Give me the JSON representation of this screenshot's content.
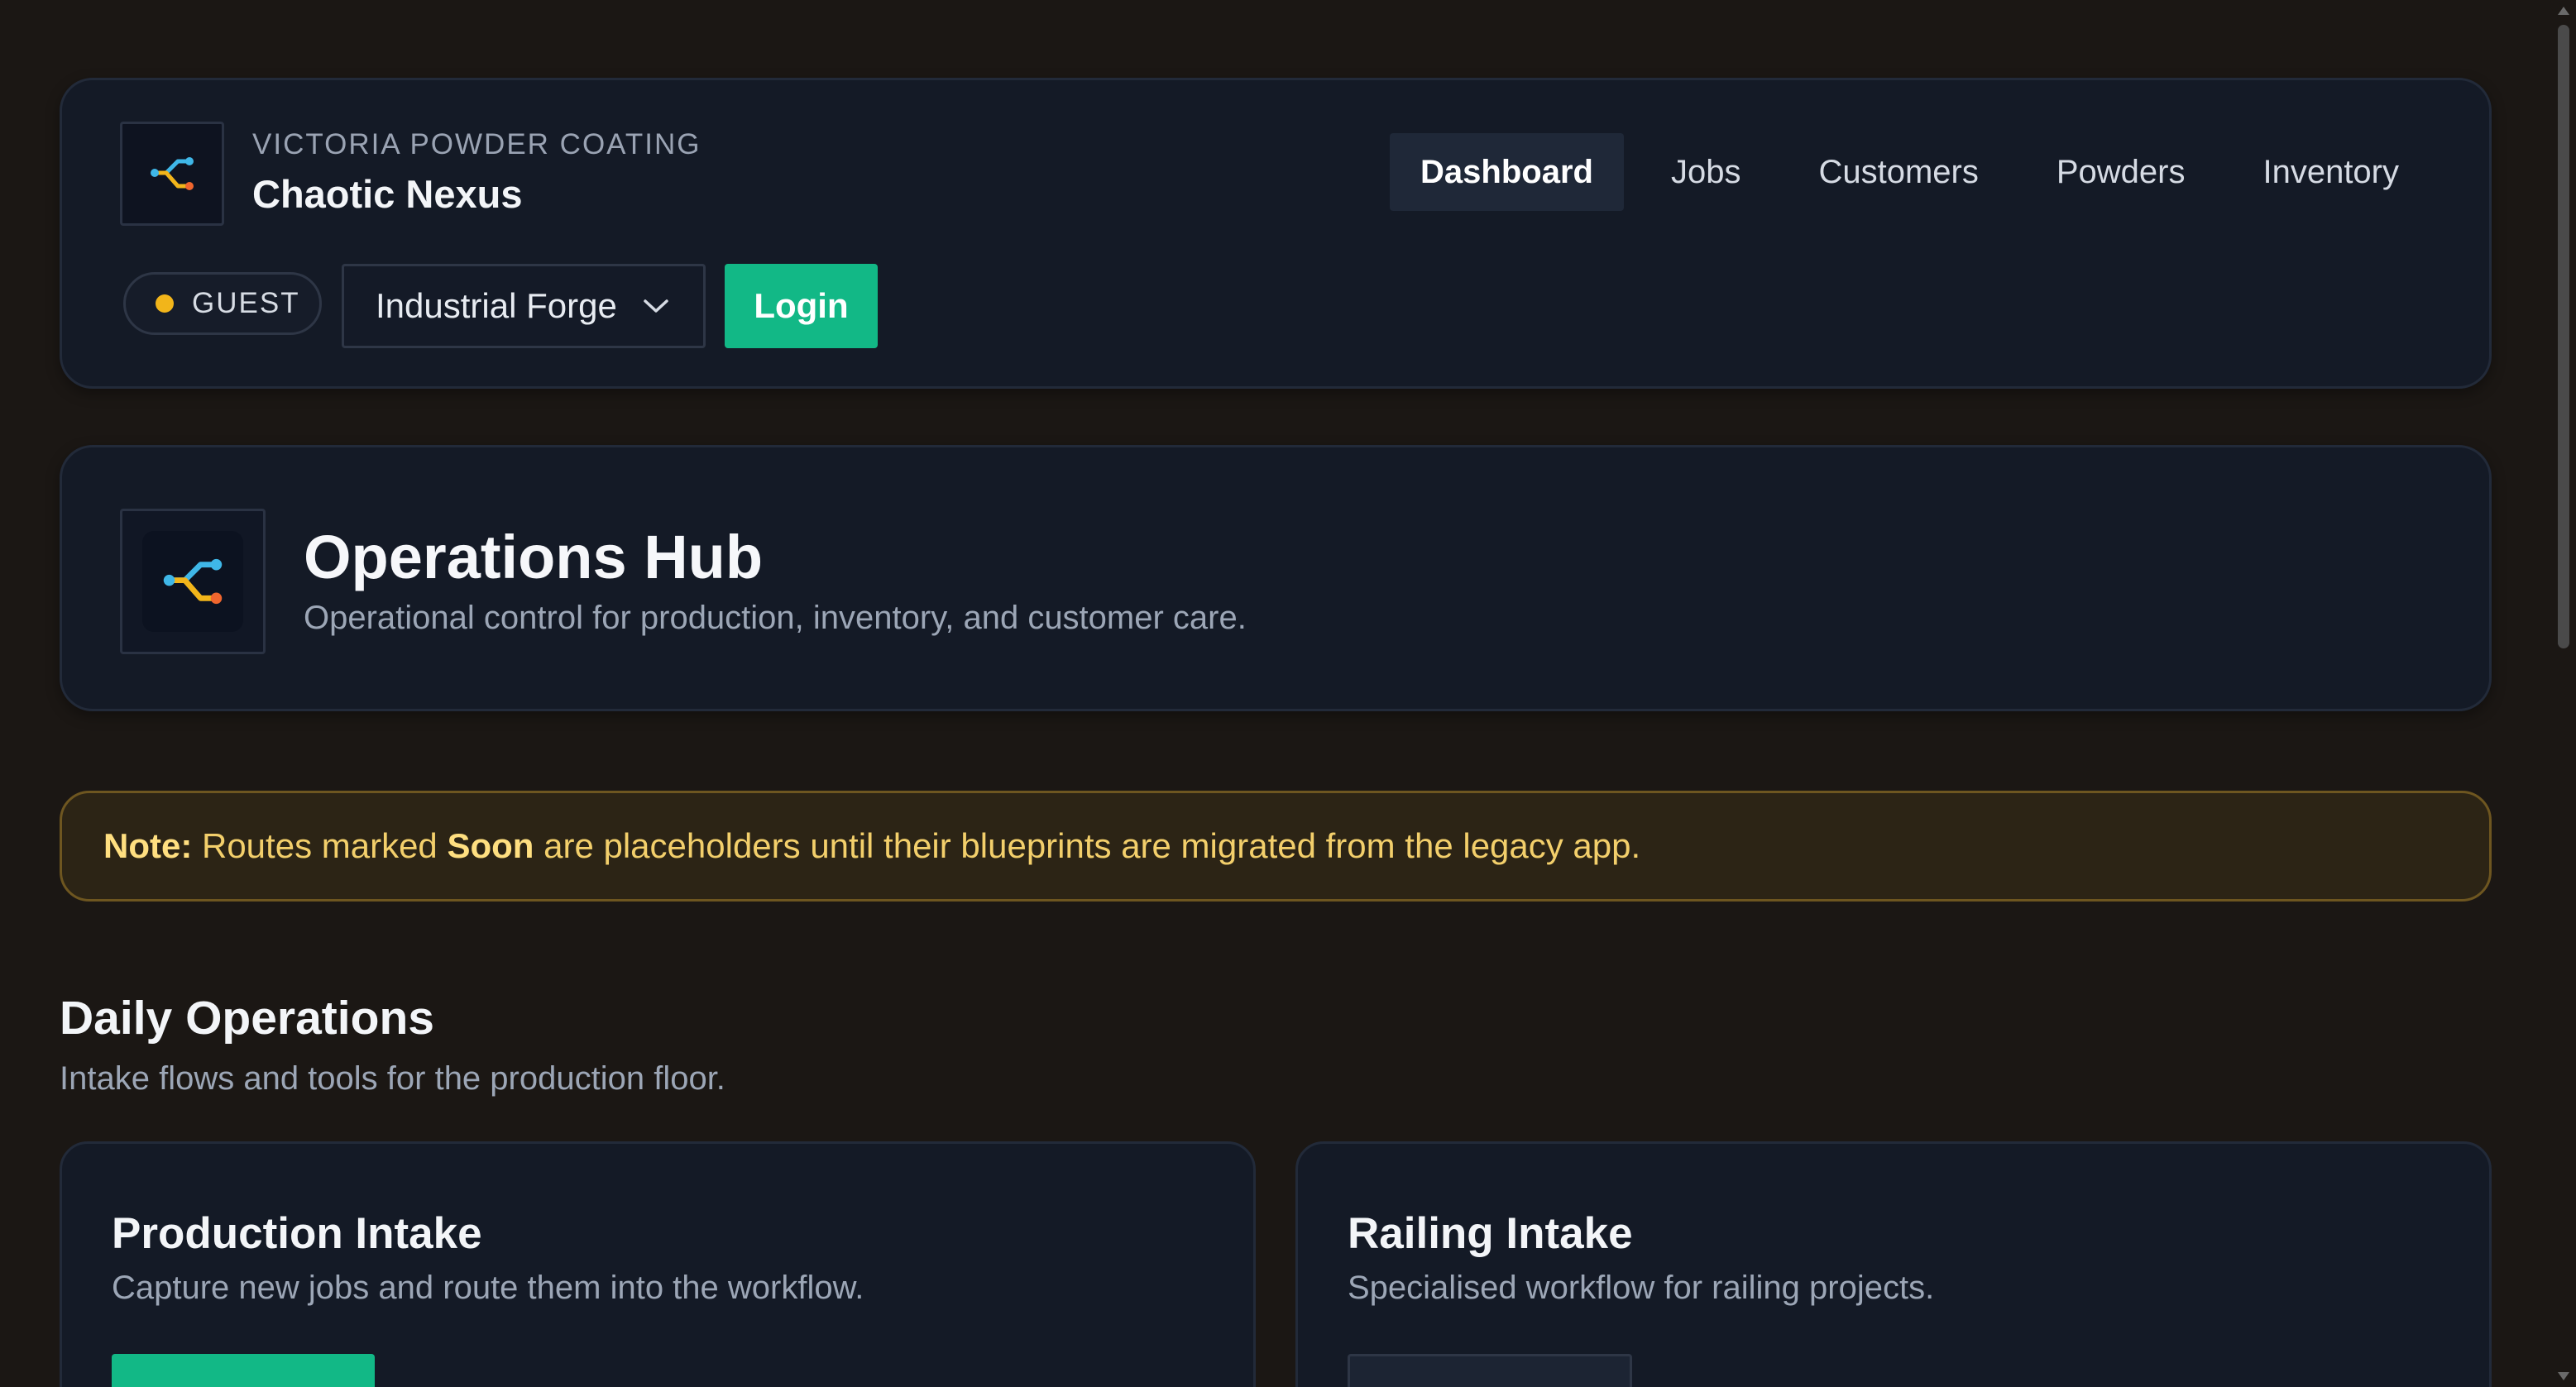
{
  "header": {
    "company": "VICTORIA POWDER COATING",
    "app_name": "Chaotic Nexus",
    "logo_icon": "flow-branch-icon",
    "nav": [
      {
        "label": "Dashboard",
        "active": true
      },
      {
        "label": "Jobs",
        "active": false
      },
      {
        "label": "Customers",
        "active": false
      },
      {
        "label": "Powders",
        "active": false
      },
      {
        "label": "Inventory",
        "active": false
      }
    ],
    "user_badge": "GUEST",
    "user_status_color": "#f2b51a",
    "theme_select": {
      "value": "Industrial Forge",
      "icon": "chevron-down-icon"
    },
    "login_label": "Login"
  },
  "hero": {
    "title": "Operations Hub",
    "subtitle": "Operational control for production, inventory, and customer care.",
    "icon": "flow-branch-icon"
  },
  "note": {
    "prefix": "Note:",
    "text_before": " Routes marked ",
    "highlight": "Soon",
    "text_after": " are placeholders until their blueprints are migrated from the legacy app."
  },
  "section": {
    "title": "Daily Operations",
    "subtitle": "Intake flows and tools for the production floor.",
    "cards": [
      {
        "title": "Production Intake",
        "description": "Capture new jobs and route them into the workflow."
      },
      {
        "title": "Railing Intake",
        "description": "Specialised workflow for railing projects."
      }
    ]
  },
  "colors": {
    "background": "#1b1714",
    "card": "#141a26",
    "accent": "#12b886",
    "note_text": "#f3cf6b"
  }
}
